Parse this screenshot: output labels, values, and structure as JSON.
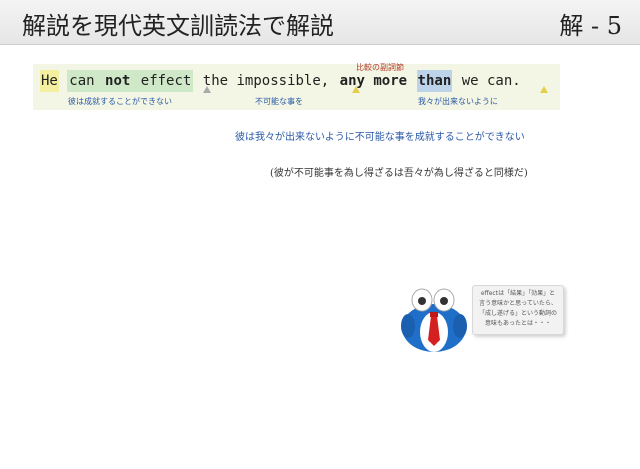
{
  "header": {
    "title": "解説を現代英文訓読法で解説",
    "page_label": "解 - 5"
  },
  "sentence": {
    "he": "He",
    "can": "can",
    "not": "not",
    "effect": "effect",
    "the_impossible": "the impossible,",
    "any_more": "any more",
    "than": "than",
    "we_can": "we can."
  },
  "annotations": {
    "above": "比較の副詞節",
    "gloss_1": "彼は成就することができない",
    "gloss_2": "不可能な事を",
    "gloss_3": "我々が出来ないように"
  },
  "translation": "彼は我々が出来ないように不可能な事を成就することができない",
  "classical": "(彼が不可能事を為し得ざるは吾々が為し得ざると同様だ)",
  "note_bubble": {
    "lines": [
      "effectは「結果」「効果」と",
      "言う意味かと思っていたら、",
      "「成し遂げる」という動詞の",
      "意味もあったとは・・・"
    ]
  },
  "colors": {
    "highlight_yellow": "#f4f0a0",
    "highlight_green": "#cfe9c8",
    "highlight_blue": "#bcd3ea",
    "gloss_blue": "#2a5aa7",
    "note_red": "#b43a2a"
  }
}
